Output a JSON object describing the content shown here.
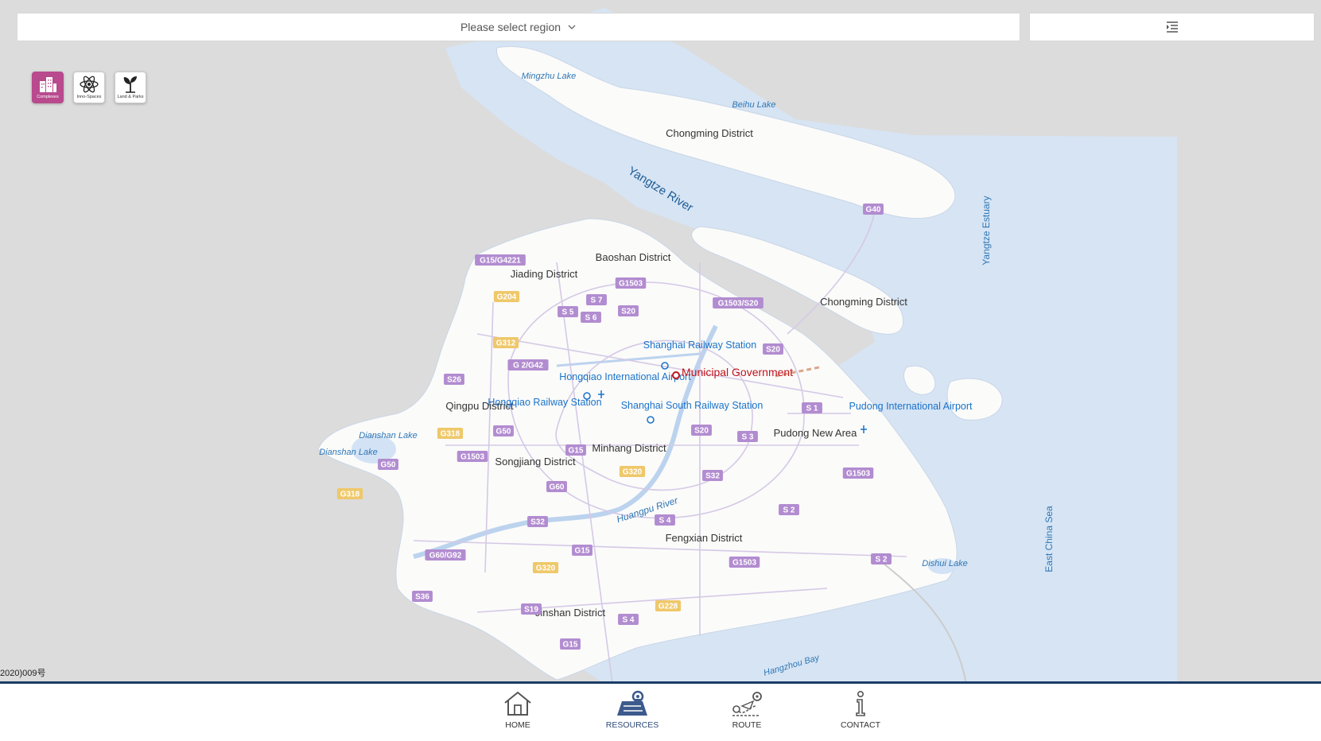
{
  "top": {
    "region_placeholder": "Please select region"
  },
  "categories": [
    {
      "label": "Complexes",
      "icon": "buildings-icon",
      "active": true
    },
    {
      "label": "Inno-Spaces",
      "icon": "atom-icon",
      "active": false
    },
    {
      "label": "Land & Parks",
      "icon": "sprout-icon",
      "active": false
    }
  ],
  "map_labels": {
    "water": {
      "mingzhu": "Mingzhu Lake",
      "beihu": "Beihu Lake",
      "yangtze_river": "Yangtze River",
      "yangtze_estuary": "Yangtze Estuary",
      "dianshan1": "Dianshan Lake",
      "dianshan2": "Dianshan Lake",
      "huangpu": "Huangpu River",
      "east_china_sea": "East China Sea",
      "dishui": "Dishui Lake",
      "hangzhou_bay": "Hangzhou Bay"
    },
    "districts": {
      "chongming_north": "Chongming District",
      "chongming_south": "Chongming District",
      "baoshan": "Baoshan District",
      "jiading": "Jiading District",
      "qingpu": "Qingpu District",
      "songjiang": "Songjiang District",
      "minhang": "Minhang District",
      "pudong": "Pudong New Area",
      "fengxian": "Fengxian District",
      "jinshan": "Jinshan District"
    },
    "pois": {
      "shanghai_rail": "Shanghai Railway Station",
      "hongqiao_airport": "Hongqiao International Airport",
      "hongqiao_rail": "Hongqiao Railway Station",
      "shanghai_south_rail": "Shanghai South Railway Station",
      "pudong_airport": "Pudong International Airport",
      "municipal_gov": "Municipal Government"
    },
    "roads": [
      "G40",
      "G15/G4221",
      "G1503",
      "G204",
      "S 7",
      "G1503/S20",
      "S 5",
      "S 6",
      "S20",
      "G312",
      "G 2/G42",
      "S20",
      "S26",
      "S 1",
      "G318",
      "G50",
      "S20",
      "S 3",
      "G1503",
      "G15",
      "G50",
      "G320",
      "S32",
      "G318",
      "G60",
      "G1503",
      "S32",
      "S 4",
      "S 2",
      "G60/G92",
      "G15",
      "G320",
      "G1503",
      "S 2",
      "S36",
      "G228",
      "S19",
      "S 4",
      "G15"
    ]
  },
  "colors": {
    "land": "#fbfbfa",
    "water": "#d3e3f5",
    "ocean": "#d6e4f4",
    "district_text": "#333333",
    "water_text": "#2f77b5",
    "poi_text": "#1a73c9",
    "gov_text": "#c0141c",
    "road_badge": "#b28cd0",
    "highway_badge": "#efc86a",
    "accent": "#b94a8e",
    "nav_border": "#1c3c66"
  },
  "footer": {
    "copyright": "2020)009号"
  },
  "nav": [
    {
      "label": "HOME",
      "icon": "home-icon"
    },
    {
      "label": "RESOURCES",
      "icon": "map-resources-icon",
      "active": true
    },
    {
      "label": "ROUTE",
      "icon": "route-icon"
    },
    {
      "label": "CONTACT",
      "icon": "info-icon"
    }
  ]
}
